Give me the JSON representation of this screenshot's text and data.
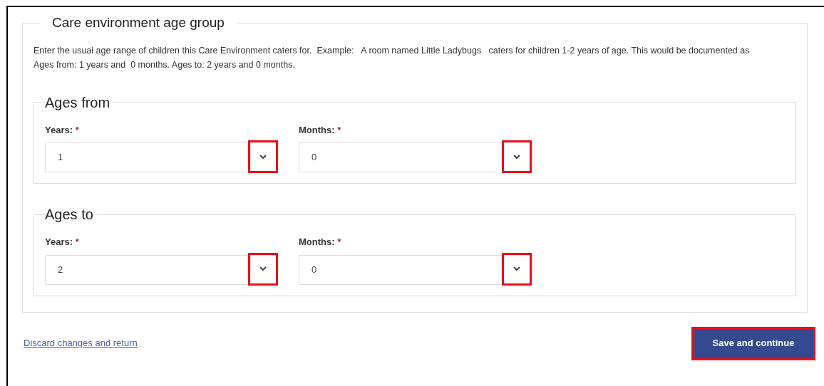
{
  "section": {
    "legend": "Care environment age group",
    "description": "Enter the usual age range of children this Care Environment caters for.  Example:   A room named Little Ladybugs   caters for children 1-2 years of age. This would be documented as Ages from: 1 years and  0 months. Ages to: 2 years and 0 months."
  },
  "groups": [
    {
      "legend": "Ages from",
      "fields": [
        {
          "label": "Years:",
          "required_mark": "*",
          "value": "1",
          "highlighted": true
        },
        {
          "label": "Months:",
          "required_mark": "*",
          "value": "0",
          "highlighted": true
        }
      ]
    },
    {
      "legend": "Ages to",
      "fields": [
        {
          "label": "Years:",
          "required_mark": "*",
          "value": "2",
          "highlighted": true
        },
        {
          "label": "Months:",
          "required_mark": "*",
          "value": "0",
          "highlighted": true
        }
      ]
    }
  ],
  "footer": {
    "discard_link": "Discard changes and return",
    "save_button": {
      "label": "Save and continue",
      "highlighted": true
    }
  }
}
